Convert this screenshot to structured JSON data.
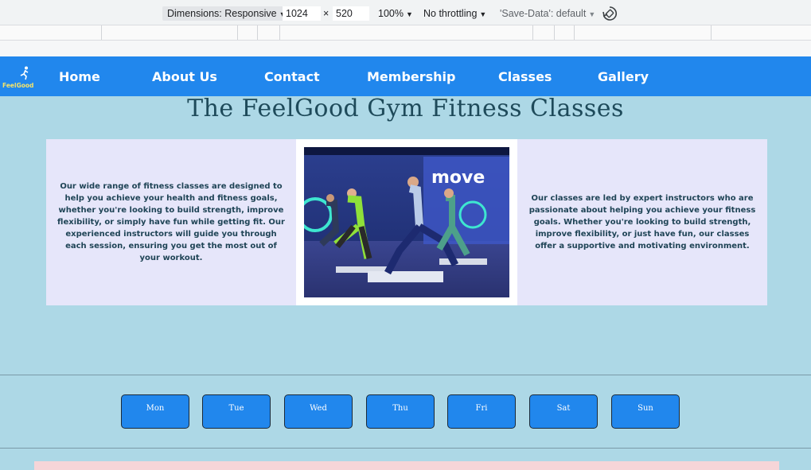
{
  "devtools": {
    "dimensions_label": "Dimensions: Responsive",
    "width_value": "1024",
    "times_symbol": "×",
    "height_value": "520",
    "zoom": "100%",
    "throttling": "No throttling",
    "save_data": "'Save-Data': default",
    "caret": "▼"
  },
  "nav": {
    "logo_text": "FeelGood",
    "links": [
      "Home",
      "About Us",
      "Contact",
      "Membership",
      "Classes",
      "Gallery"
    ]
  },
  "page_title": "The FeelGood Gym Fitness Classes",
  "info": {
    "left_text": "Our wide range of fitness classes are designed to help you achieve your health and fitness goals, whether you're looking to build strength, improve flexibility, or simply have fun while getting fit. Our experienced instructors will guide you through each session, ensuring you get the most out of your workout.",
    "right_text": "Our classes are led by expert instructors who are passionate about helping you achieve your fitness goals. Whether you're looking to build strength, improve flexibility, or just have fun, our classes offer a supportive and motivating environment.",
    "photo_sign": "move"
  },
  "days": [
    "Mon",
    "Tue",
    "Wed",
    "Thu",
    "Fri",
    "Sat",
    "Sun"
  ],
  "colors": {
    "page_bg": "#add8e6",
    "navbar": "#2187ed",
    "card_bg": "#e6e6fa",
    "title": "#1e4a5a",
    "day_button": "#2187ed"
  }
}
